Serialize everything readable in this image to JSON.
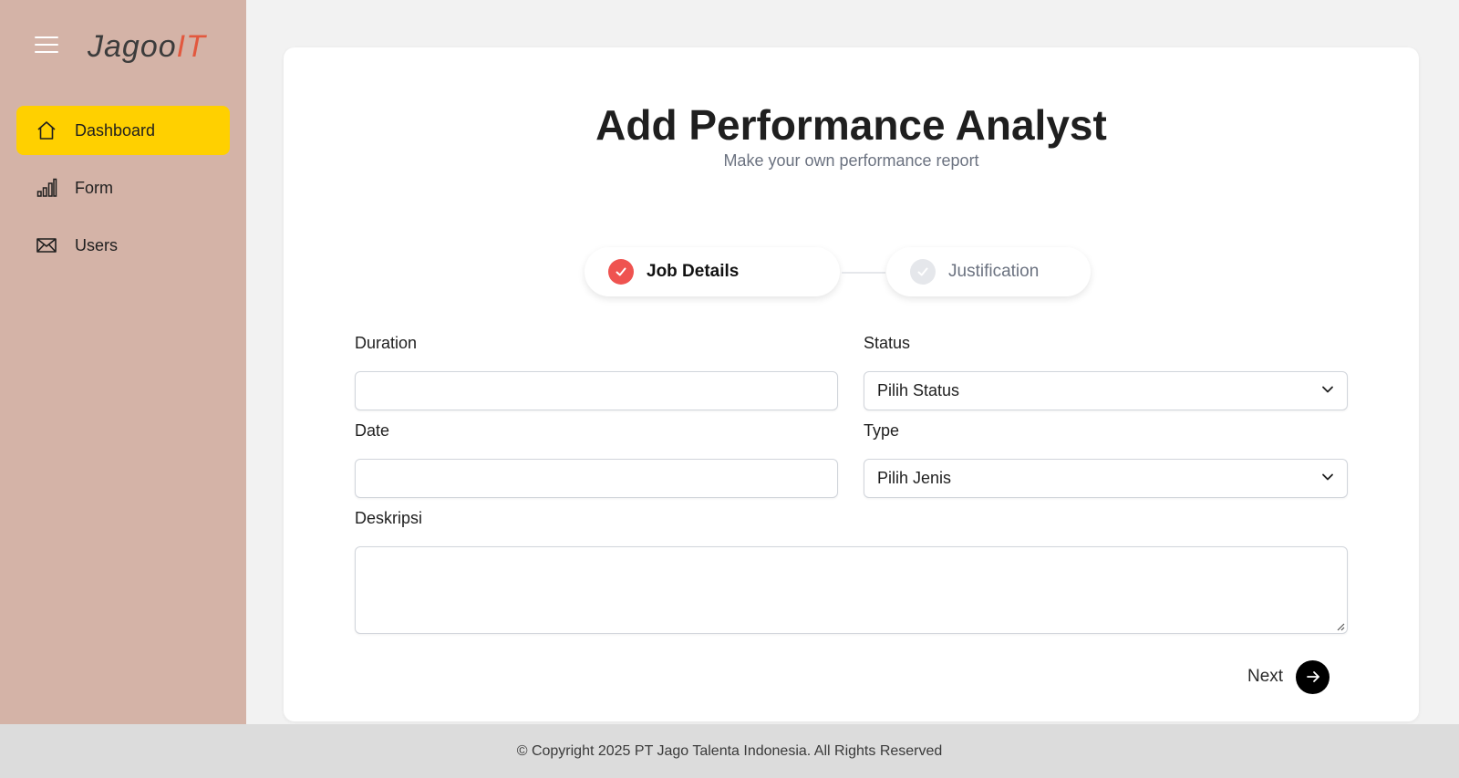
{
  "brand": {
    "logo_main": "Jagoo",
    "logo_accent": "IT",
    "accent_color": "#e2583e"
  },
  "sidebar": {
    "background": "#d4b3a7",
    "active_color": "#ffd000",
    "items": [
      {
        "label": "Dashboard",
        "icon": "home-icon",
        "active": true
      },
      {
        "label": "Form",
        "icon": "bar-chart-icon",
        "active": false
      },
      {
        "label": "Users",
        "icon": "mail-icon",
        "active": false
      }
    ]
  },
  "header": {
    "title": "Add Performance Analyst",
    "subtitle": "Make your own performance report"
  },
  "stepper": {
    "steps": [
      {
        "label": "Job Details",
        "completed": true,
        "color": "#ef5350"
      },
      {
        "label": "Justification",
        "completed": false,
        "color": "#e5e7eb"
      }
    ]
  },
  "form": {
    "duration": {
      "label": "Duration",
      "value": ""
    },
    "status": {
      "label": "Status",
      "selected": "Pilih Status"
    },
    "date": {
      "label": "Date",
      "value": ""
    },
    "type": {
      "label": "Type",
      "selected": "Pilih Jenis"
    },
    "description": {
      "label": "Deskripsi",
      "value": ""
    }
  },
  "actions": {
    "next_label": "Next"
  },
  "footer": {
    "text": "© Copyright 2025 PT Jago Talenta Indonesia. All Rights Reserved"
  }
}
